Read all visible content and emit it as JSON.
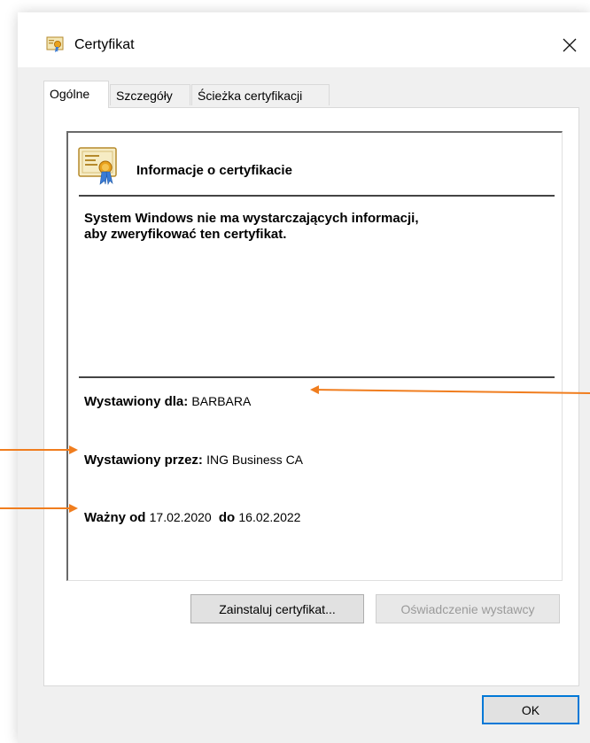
{
  "window": {
    "title": "Certyfikat"
  },
  "tabs": [
    {
      "label": "Ogólne",
      "active": true
    },
    {
      "label": "Szczegóły",
      "active": false
    },
    {
      "label": "Ścieżka certyfikacji",
      "active": false
    }
  ],
  "info": {
    "heading": "Informacje o certyfikacie",
    "warning_line1": "System Windows nie ma wystarczających informacji,",
    "warning_line2": "aby zweryfikować ten certyfikat.",
    "issued_to_label": "Wystawiony dla:",
    "issued_to_value": "BARBARA",
    "issued_by_label": "Wystawiony przez:",
    "issued_by_value": "ING Business CA",
    "valid_from_label": "Ważny od",
    "valid_from_value": "17.02.2020",
    "valid_to_label": "do",
    "valid_to_value": "16.02.2022"
  },
  "buttons": {
    "install": "Zainstaluj certyfikat...",
    "issuer_statement": "Oświadczenie wystawcy",
    "ok": "OK"
  },
  "colors": {
    "annotation_arrow": "#f07d1e",
    "default_button_border": "#0078d7"
  }
}
